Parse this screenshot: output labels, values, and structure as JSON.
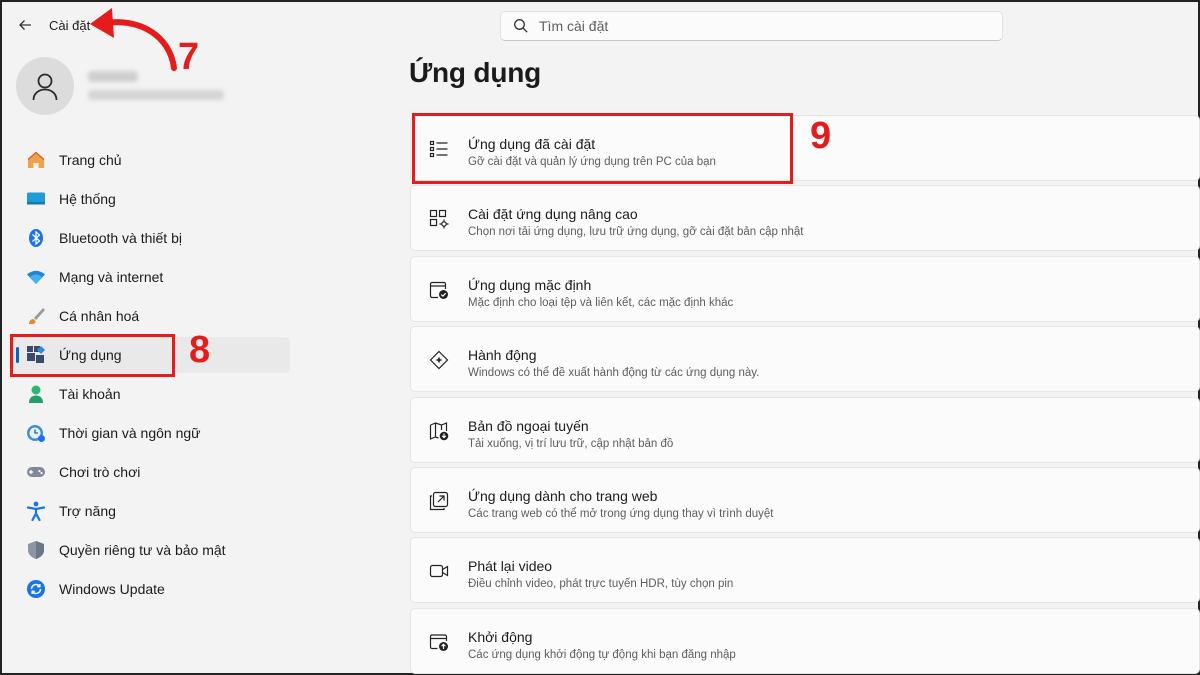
{
  "window": {
    "title": "Cài đặt"
  },
  "search": {
    "placeholder": "Tìm cài đặt"
  },
  "sidebar": {
    "items": [
      {
        "label": "Trang chủ",
        "icon": "home-icon"
      },
      {
        "label": "Hệ thống",
        "icon": "system-icon"
      },
      {
        "label": "Bluetooth và thiết bị",
        "icon": "bluetooth-icon"
      },
      {
        "label": "Mạng và internet",
        "icon": "wifi-icon"
      },
      {
        "label": "Cá nhân hoá",
        "icon": "brush-icon"
      },
      {
        "label": "Ứng dụng",
        "icon": "apps-icon",
        "active": true
      },
      {
        "label": "Tài khoản",
        "icon": "account-icon"
      },
      {
        "label": "Thời gian và ngôn ngữ",
        "icon": "clock-globe-icon"
      },
      {
        "label": "Chơi trò chơi",
        "icon": "gamepad-icon"
      },
      {
        "label": "Trợ năng",
        "icon": "accessibility-icon"
      },
      {
        "label": "Quyền riêng tư và bảo mật",
        "icon": "shield-icon"
      },
      {
        "label": "Windows Update",
        "icon": "update-icon"
      }
    ]
  },
  "main": {
    "title": "Ứng dụng",
    "cards": [
      {
        "title": "Ứng dụng đã cài đặt",
        "desc": "Gỡ cài đặt và quản lý ứng dụng trên PC của bạn",
        "icon": "list-icon"
      },
      {
        "title": "Cài đặt ứng dụng nâng cao",
        "desc": "Chọn nơi tải ứng dụng, lưu trữ ứng dụng, gỡ cài đặt bản cập nhật",
        "icon": "apps-gear-icon"
      },
      {
        "title": "Ứng dụng mặc định",
        "desc": "Mặc định cho loại tệp và liên kết, các mặc định khác",
        "icon": "default-apps-icon"
      },
      {
        "title": "Hành động",
        "desc": "Windows có thể đề xuất hành động từ các ứng dụng này.",
        "icon": "sparkle-diamond-icon"
      },
      {
        "title": "Bản đồ ngoại tuyến",
        "desc": "Tải xuống, vị trí lưu trữ, cập nhật bản đồ",
        "icon": "offline-map-icon"
      },
      {
        "title": "Ứng dụng dành cho trang web",
        "desc": "Các trang web có thể mở trong ứng dụng thay vì trình duyệt",
        "icon": "open-external-icon"
      },
      {
        "title": "Phát lại video",
        "desc": "Điều chỉnh video, phát trực tuyến HDR, tùy chọn pin",
        "icon": "video-icon"
      },
      {
        "title": "Khởi động",
        "desc": "Các ứng dụng khởi động tự động khi bạn đăng nhập",
        "icon": "startup-icon"
      }
    ]
  },
  "annotations": {
    "step7": "7",
    "step8": "8",
    "step9": "9",
    "color": "#e41c1c"
  },
  "colors": {
    "accent": "#0067c0",
    "background": "#f3f3f3",
    "card": "#fbfbfb"
  }
}
